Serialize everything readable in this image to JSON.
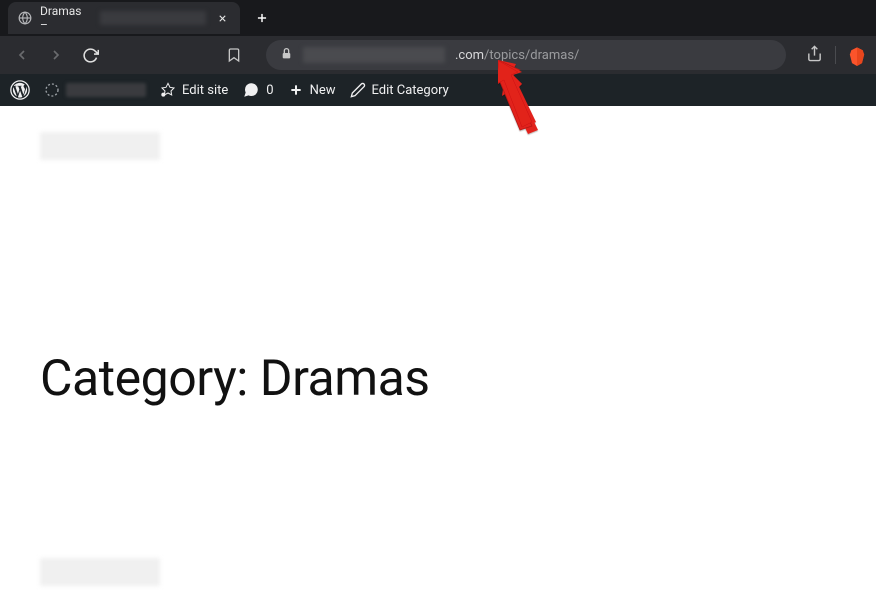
{
  "browser": {
    "tab": {
      "title_prefix": "Dramas –"
    },
    "url": {
      "host_suffix": ".com",
      "path": "/topics/dramas/"
    }
  },
  "wp_adminbar": {
    "edit_site": "Edit site",
    "comments_count": "0",
    "new": "New",
    "edit_category": "Edit Category"
  },
  "page": {
    "heading": "Category: Dramas"
  }
}
